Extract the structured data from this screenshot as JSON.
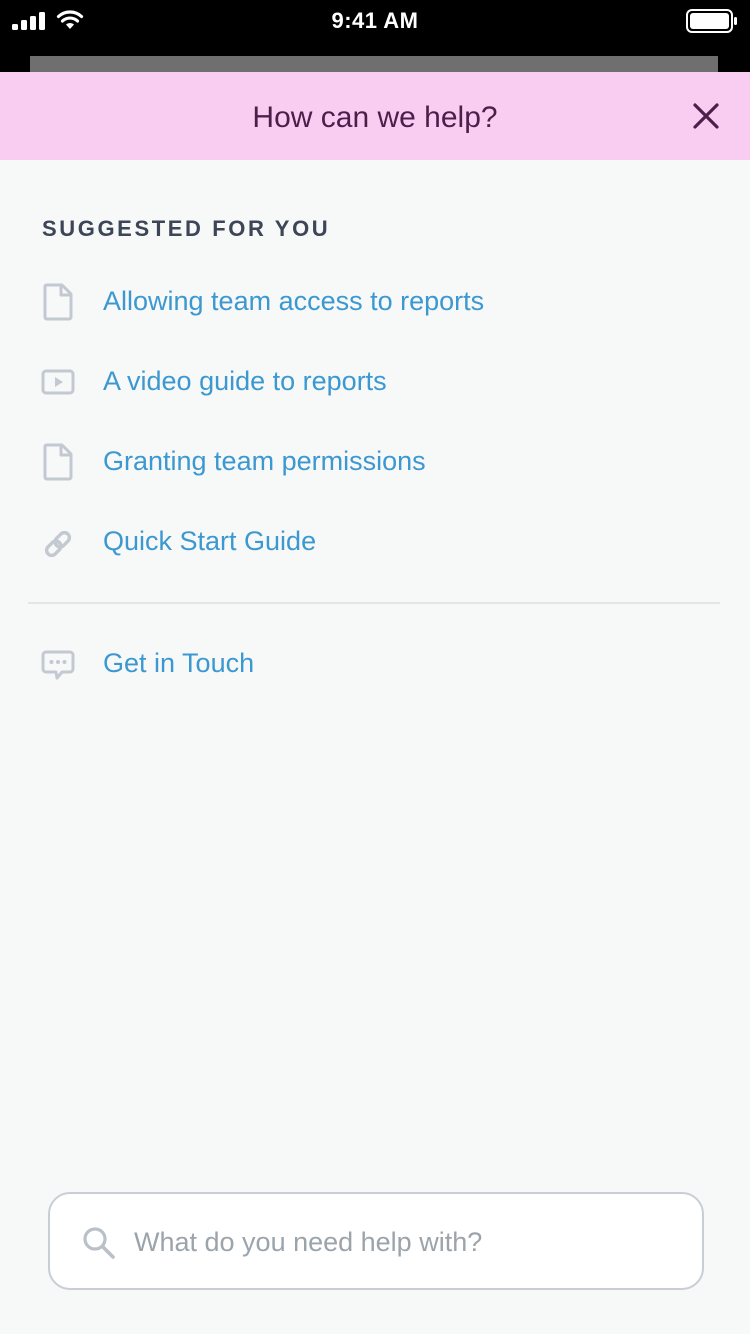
{
  "status_bar": {
    "time": "9:41 AM"
  },
  "header": {
    "title": "How can we help?",
    "close_icon": "close-icon"
  },
  "suggestions": {
    "heading": "SUGGESTED FOR YOU",
    "items": [
      {
        "label": "Allowing team access to reports",
        "icon": "document-icon"
      },
      {
        "label": "A video guide to reports",
        "icon": "video-icon"
      },
      {
        "label": "Granting team permissions",
        "icon": "document-icon"
      },
      {
        "label": "Quick Start Guide",
        "icon": "link-icon"
      }
    ]
  },
  "contact": {
    "label": "Get in Touch",
    "icon": "chat-bubble-icon"
  },
  "search": {
    "placeholder": "What do you need help with?",
    "value": ""
  },
  "colors": {
    "header_bg": "#f9cdf1",
    "title_text": "#4b1f4a",
    "link": "#3b98d0",
    "icon_gray": "#c3c9d0",
    "heading_text": "#3d4656",
    "page_bg": "#f7f8f8"
  }
}
